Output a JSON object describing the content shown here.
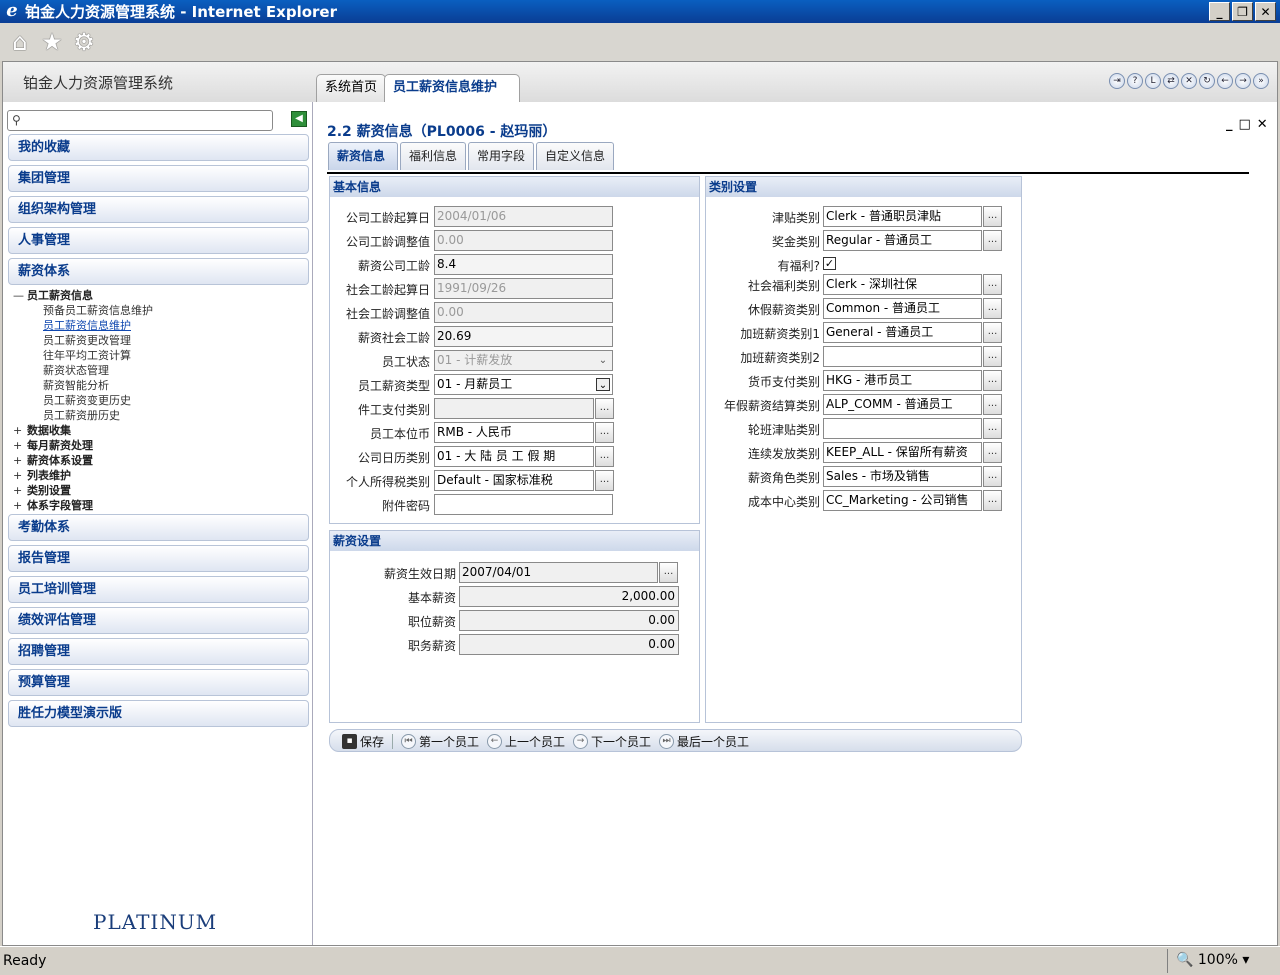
{
  "browser": {
    "title": "铂金人力资源管理系统 - Internet Explorer",
    "ie_icon": "e",
    "min_btn": "_",
    "restore_btn": "❐",
    "close_btn": "✕",
    "toolbar_icons": [
      "home-icon",
      "star-icon",
      "gear-icon"
    ],
    "status": "Ready",
    "zoom": "100%"
  },
  "app": {
    "brand": "铂金人力资源管理系统",
    "tabs": [
      {
        "label": "系统首页",
        "active": false
      },
      {
        "label": "员工薪资信息维护",
        "active": true
      }
    ]
  },
  "sidebar": {
    "search_placeholder": "",
    "collapse_icon": "◀",
    "sections_top": [
      "我的收藏",
      "集团管理",
      "组织架构管理",
      "人事管理",
      "薪资体系"
    ],
    "tree": {
      "expanded_node": "员工薪资信息",
      "expanded_sign": "—",
      "collapsed_sign": "+",
      "children": [
        "预备员工薪资信息维护",
        "员工薪资信息维护",
        "员工薪资更改管理",
        "往年平均工资计算",
        "薪资状态管理",
        "薪资智能分析",
        "员工薪资变更历史",
        "员工薪资册历史"
      ],
      "collapsed_nodes": [
        "数据收集",
        "每月薪资处理",
        "薪资体系设置",
        "列表维护",
        "类别设置",
        "体系字段管理"
      ]
    },
    "sections_bottom": [
      "考勤体系",
      "报告管理",
      "员工培训管理",
      "绩效评估管理",
      "招聘管理",
      "预算管理",
      "胜任力模型演示版"
    ],
    "logo_text": "PLATINUM"
  },
  "main": {
    "title": "2.2 薪资信息（PL0006 - 赵玛丽）",
    "win_ctrls": [
      "_",
      "□",
      "✕"
    ],
    "subtabs": [
      "薪资信息",
      "福利信息",
      "常用字段",
      "自定义信息"
    ],
    "basic": {
      "header": "基本信息",
      "fields": [
        {
          "label": "公司工龄起算日",
          "value": "2004/01/06"
        },
        {
          "label": "公司工龄调整值",
          "value": "0.00"
        },
        {
          "label": "薪资公司工龄",
          "value": "8.4"
        },
        {
          "label": "社会工龄起算日",
          "value": "1991/09/26"
        },
        {
          "label": "社会工龄调整值",
          "value": "0.00"
        },
        {
          "label": "薪资社会工龄",
          "value": "20.69"
        },
        {
          "label": "员工状态",
          "value": "01 - 计薪发放"
        },
        {
          "label": "员工薪资类型",
          "value": "01 - 月薪员工"
        },
        {
          "label": "件工支付类别",
          "value": ""
        },
        {
          "label": "员工本位币",
          "value": "RMB - 人民币"
        },
        {
          "label": "公司日历类别",
          "value": "01 - 大 陆 员 工 假 期"
        },
        {
          "label": "个人所得税类别",
          "value": "Default - 国家标准税"
        },
        {
          "label": "附件密码",
          "value": ""
        }
      ]
    },
    "category": {
      "header": "类别设置",
      "fields": [
        {
          "label": "津贴类别",
          "value": "Clerk - 普通职员津贴"
        },
        {
          "label": "奖金类别",
          "value": "Regular - 普通员工"
        },
        {
          "label": "有福利?",
          "value": "✓"
        },
        {
          "label": "社会福利类别",
          "value": "Clerk - 深圳社保"
        },
        {
          "label": "休假薪资类别",
          "value": "Common - 普通员工"
        },
        {
          "label": "加班薪资类别1",
          "value": "General - 普通员工"
        },
        {
          "label": "加班薪资类别2",
          "value": ""
        },
        {
          "label": "货币支付类别",
          "value": "HKG - 港币员工"
        },
        {
          "label": "年假薪资结算类别",
          "value": "ALP_COMM - 普通员工"
        },
        {
          "label": "轮班津贴类别",
          "value": ""
        },
        {
          "label": "连续发放类别",
          "value": "KEEP_ALL - 保留所有薪资"
        },
        {
          "label": "薪资角色类别",
          "value": "Sales - 市场及销售"
        },
        {
          "label": "成本中心类别",
          "value": "CC_Marketing - 公司销售"
        }
      ]
    },
    "salary": {
      "header": "薪资设置",
      "fields": [
        {
          "label": "薪资生效日期",
          "value": "2007/04/01"
        },
        {
          "label": "基本薪资",
          "value": "2,000.00"
        },
        {
          "label": "职位薪资",
          "value": "0.00"
        },
        {
          "label": "职务薪资",
          "value": "0.00"
        }
      ]
    },
    "ellipsis": "...",
    "actions": {
      "save": "保存",
      "first": "第一个员工",
      "prev": "上一个员工",
      "next": "下一个员工",
      "last": "最后一个员工"
    },
    "colors": {
      "accent": "#0a3c8c",
      "panel_header": "#cdd8ea"
    }
  }
}
